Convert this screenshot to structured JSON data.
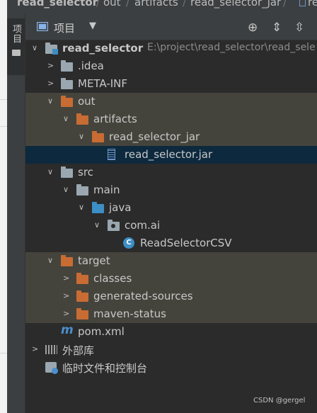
{
  "breadcrumb": {
    "items": [
      "read_selector",
      "out",
      "artifacts",
      "read_selector_jar",
      "re"
    ],
    "separator": "/"
  },
  "tool_stripe": {
    "project_label": "项目"
  },
  "panel_header": {
    "view_label": "项目",
    "caret": "▼",
    "buttons": [
      {
        "name": "locate-icon",
        "glyph": "⊕"
      },
      {
        "name": "expand-all-icon",
        "glyph": "⇕"
      },
      {
        "name": "collapse-all-icon",
        "glyph": "⇳"
      }
    ]
  },
  "tree": [
    {
      "label": "read_selector",
      "path": "E:\\project\\read_selector\\read_sele",
      "icon": "module-folder",
      "expanded": true,
      "level": 0
    },
    {
      "label": ".idea",
      "icon": "folder-grey",
      "expanded": false,
      "level": 1
    },
    {
      "label": "META-INF",
      "icon": "folder-grey",
      "expanded": false,
      "level": 1
    },
    {
      "label": "out",
      "icon": "folder-orange",
      "expanded": true,
      "level": 1,
      "highlight": true
    },
    {
      "label": "artifacts",
      "icon": "folder-orange",
      "expanded": true,
      "level": 2,
      "highlight": true
    },
    {
      "label": "read_selector_jar",
      "icon": "folder-orange",
      "expanded": true,
      "level": 3,
      "highlight": true
    },
    {
      "label": "read_selector.jar",
      "icon": "jar-icon",
      "level": 4,
      "selected": true
    },
    {
      "label": "src",
      "icon": "folder-grey",
      "expanded": true,
      "level": 1
    },
    {
      "label": "main",
      "icon": "folder-grey",
      "expanded": true,
      "level": 2
    },
    {
      "label": "java",
      "icon": "folder-blue",
      "expanded": true,
      "level": 3
    },
    {
      "label": "com.ai",
      "icon": "package-icon",
      "expanded": true,
      "level": 4
    },
    {
      "label": "ReadSelectorCSV",
      "icon": "class-icon",
      "level": 5
    },
    {
      "label": "target",
      "icon": "folder-orange",
      "expanded": true,
      "level": 1,
      "highlight": true
    },
    {
      "label": "classes",
      "icon": "folder-orange",
      "expanded": false,
      "level": 2,
      "highlight": true
    },
    {
      "label": "generated-sources",
      "icon": "folder-orange",
      "expanded": false,
      "level": 2,
      "highlight": true
    },
    {
      "label": "maven-status",
      "icon": "folder-orange",
      "expanded": false,
      "level": 2,
      "highlight": true
    },
    {
      "label": "pom.xml",
      "icon": "maven-icon",
      "level": 1
    },
    {
      "label": "外部库",
      "icon": "libraries-icon",
      "expanded": false,
      "level": 0
    },
    {
      "label": "临时文件和控制台",
      "icon": "scratches-icon",
      "level": 0
    }
  ],
  "watermark": "CSDN @gergel",
  "colors": {
    "background": "#2b2b2b",
    "panel": "#3c3f41",
    "excluded_highlight": "#45443c",
    "selection": "#0d293e",
    "excluded_folder": "#c86c34",
    "source_folder": "#3d8ec5"
  }
}
